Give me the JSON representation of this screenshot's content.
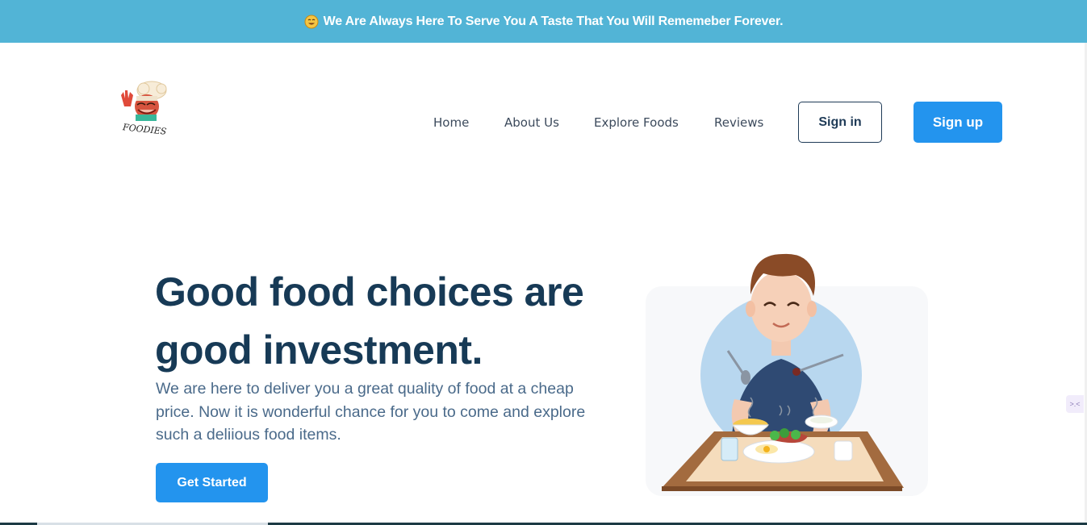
{
  "announcement": {
    "emoji": "smiling-face-emoji",
    "text": "We Are Always Here To Serve You A Taste That You Will Rememeber Forever."
  },
  "logo": {
    "name": "chef-logo",
    "text": "FOODIES"
  },
  "nav": {
    "links": [
      "Home",
      "About Us",
      "Explore Foods",
      "Reviews"
    ],
    "signin_label": "Sign in",
    "signup_label": "Sign up"
  },
  "hero": {
    "title_line1": "Good food choices are",
    "title_line2": "good investment.",
    "description": "We are here to deliver you a great quality of food at a cheap price. Now it is wonderful chance for you to come and explore such a deliious food items.",
    "cta_label": "Get Started",
    "illustration": "man-eating-meal-illustration"
  },
  "colors": {
    "topbar": "#52b4d6",
    "primary": "#2394ee",
    "heading": "#173a56",
    "body_text": "#4a6a8a"
  },
  "side_widget": {
    "text": ">.<"
  }
}
